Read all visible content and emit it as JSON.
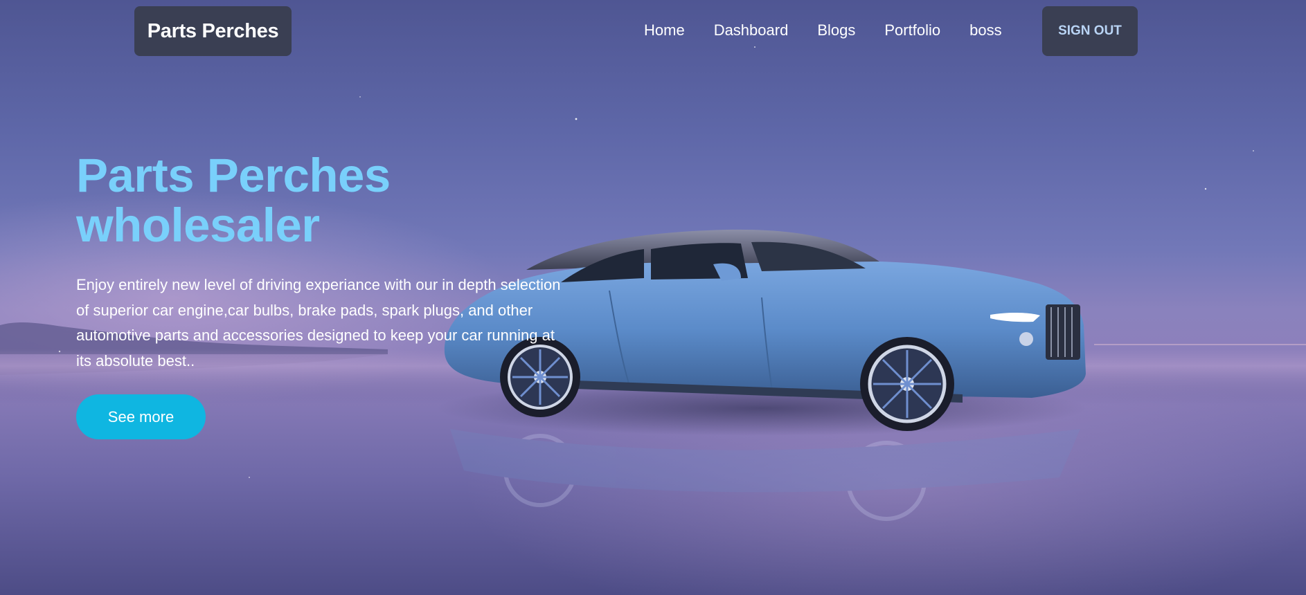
{
  "navbar": {
    "brand": "Parts Perches",
    "links": [
      "Home",
      "Dashboard",
      "Blogs",
      "Portfolio",
      "boss"
    ],
    "sign_out_label": "SIGN OUT"
  },
  "hero": {
    "title_line1": "Parts Perches",
    "title_line2": "wholesaler",
    "description": "Enjoy entirely new level of driving experiance with our in depth selection of superior car engine,car bulbs, brake pads, spark plugs, and other automotive parts and accessories designed to keep your car running at its absolute best..",
    "button_label": "See more",
    "image": "blue-convertible-car-photo"
  },
  "colors": {
    "title": "#79d0fb",
    "button": "#0fb6e1",
    "nav_box": "#3a3f53",
    "sign_out_text": "#b9d4f5",
    "car_body": "#5b8bc9"
  }
}
